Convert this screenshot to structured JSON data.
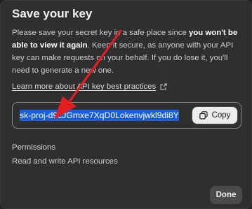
{
  "dialog": {
    "title": "Save your key",
    "description": {
      "part1": "Please save your secret key in a safe place since ",
      "bold": "you won't be able to view it again",
      "part2": ". Keep it secure, as anyone with your API key can make requests on your behalf. If you do lose it, you'll need to generate a new one."
    },
    "learn_link": {
      "label": "Learn more about API key best practices",
      "icon": "external-link-icon"
    },
    "key_field": {
      "value": "sk-proj-d9cJGmxe7XqD0Lokenvjwkl9di8Y",
      "selected": true,
      "selection_color": "#1a5ee0"
    },
    "copy_button": {
      "label": "Copy",
      "icon": "copy-icon"
    },
    "permissions": {
      "heading": "Permissions",
      "value": "Read and write API resources"
    },
    "done_button": {
      "label": "Done"
    }
  },
  "annotation": {
    "shape": "arrow",
    "color": "#e02020"
  },
  "colors": {
    "dialog_bg": "#2f2f2f",
    "button_bg": "#4b4b4b",
    "copy_bg": "#ececec",
    "border": "#8e8e8e"
  }
}
